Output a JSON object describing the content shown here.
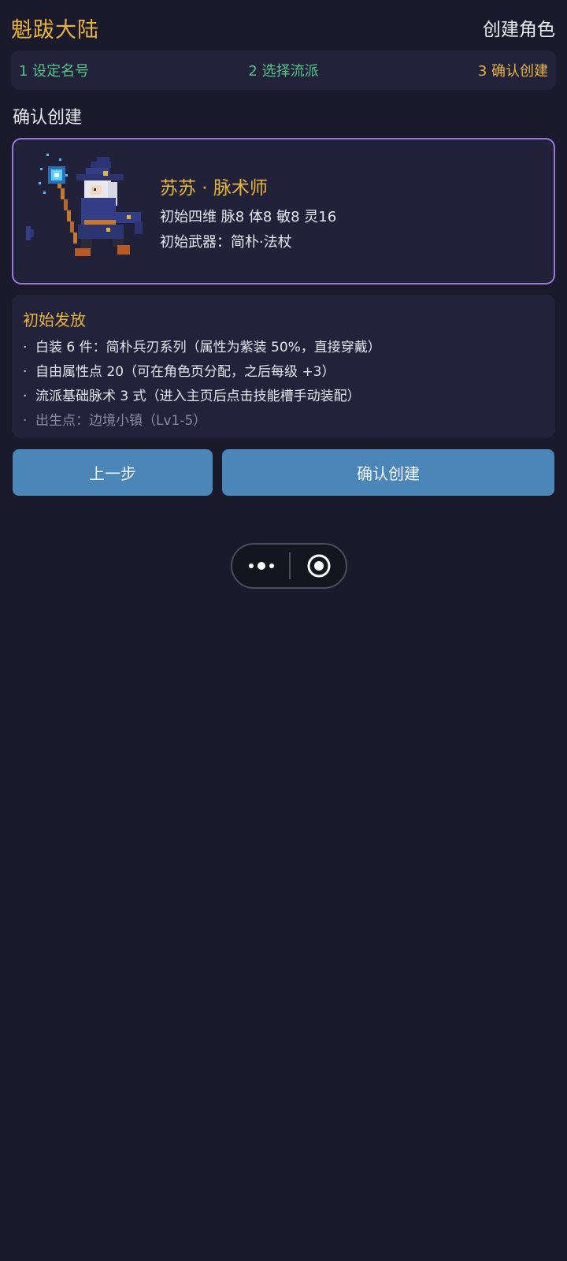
{
  "header": {
    "app_title": "魁跋大陆",
    "page_title": "创建角色"
  },
  "steps": [
    {
      "label": "1 设定名号",
      "state": "done"
    },
    {
      "label": "2 选择流派",
      "state": "done"
    },
    {
      "label": "3 确认创建",
      "state": "active"
    }
  ],
  "section_title": "确认创建",
  "character": {
    "name": "苏苏 · 脉术师",
    "stats": "初始四维 脉8 体8 敏8 灵16",
    "weapon": "初始武器：简朴·法杖",
    "avatar_icon": "pixel-mage-icon"
  },
  "rewards": {
    "title": "初始发放",
    "items": [
      "白装 6 件：简朴兵刃系列（属性为紫装 50%，直接穿戴）",
      "自由属性点 20（可在角色页分配，之后每级 +3）",
      "流派基础脉术 3 式（进入主页后点击技能槽手动装配）",
      "出生点：边境小镇（Lv1-5）"
    ],
    "bullet": "·"
  },
  "buttons": {
    "back": "上一步",
    "confirm": "确认创建"
  },
  "colors": {
    "background": "#1a1a2c",
    "accent_gold": "#e6b43c",
    "step_done": "#55c488",
    "card_border": "#9a78d8",
    "button": "#4a86b8"
  }
}
